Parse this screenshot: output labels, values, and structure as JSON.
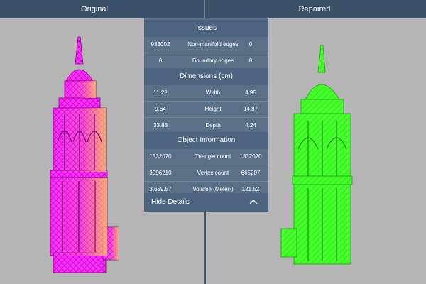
{
  "header": {
    "left_label": "Original",
    "right_label": "Repaired"
  },
  "colors": {
    "original_mesh": "#ff2cff",
    "original_tint": "#ffd54d",
    "repaired_mesh": "#44ff2c",
    "panel": "#5a7088",
    "topbar": "#3a5068"
  },
  "panel": {
    "issues_title": "Issues",
    "issues": [
      {
        "original": "933002",
        "label": "Non-manifold edges",
        "repaired": "0"
      },
      {
        "original": "0",
        "label": "Boundary edges",
        "repaired": "0"
      }
    ],
    "dimensions_title": "Dimensions (cm)",
    "dimensions": [
      {
        "original": "11.22",
        "label": "Width",
        "repaired": "4.95"
      },
      {
        "original": "9.64",
        "label": "Height",
        "repaired": "14.87"
      },
      {
        "original": "33.83",
        "label": "Depth",
        "repaired": "4.24"
      }
    ],
    "object_title": "Object Information",
    "object": [
      {
        "original": "1332070",
        "label": "Triangle count",
        "repaired": "1332070"
      },
      {
        "original": "3996210",
        "label": "Vertex count",
        "repaired": "665207"
      },
      {
        "original": "3,659.57",
        "label": "Volume (Meter³)",
        "repaired": "121.52"
      }
    ],
    "hide_label": "Hide Details",
    "hide_icon": "chevron-up-icon"
  }
}
